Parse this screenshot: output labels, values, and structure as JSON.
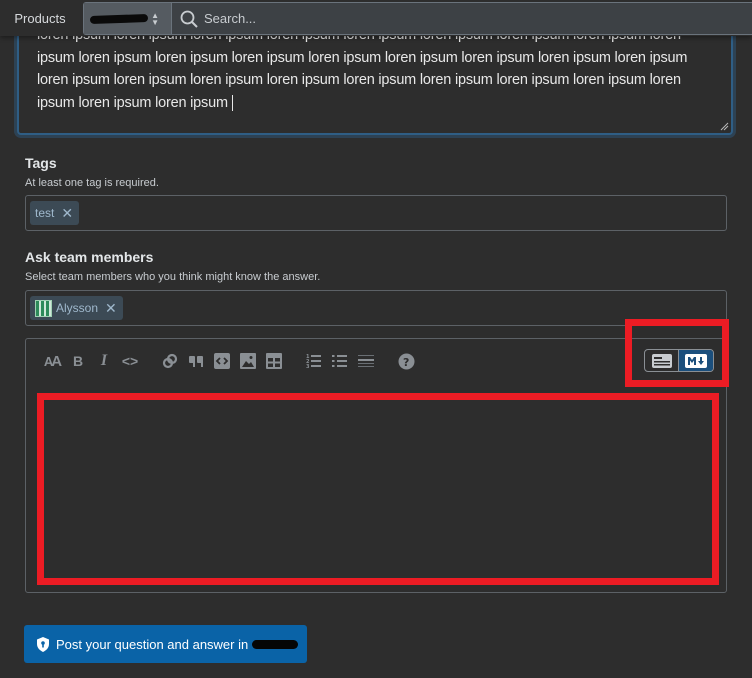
{
  "topbar": {
    "products_label": "Products",
    "search_scope": "[redacted]",
    "search_placeholder": "Search..."
  },
  "body": {
    "text": "loren ipsum loren ipsum loren ipsum loren ipsum loren ipsum loren ipsum loren ipsum loren ipsum loren ipsum loren ipsum loren ipsum loren ipsum loren ipsum loren ipsum loren ipsum loren ipsum loren ipsum loren ipsum loren ipsum loren ipsum loren ipsum loren ipsum loren ipsum loren ipsum loren ipsum loren ipsum loren ipsum loren ipsum"
  },
  "tags": {
    "label": "Tags",
    "description": "At least one tag is required.",
    "items": [
      {
        "label": "test"
      }
    ]
  },
  "team": {
    "label": "Ask team members",
    "description": "Select team members who you think might know the answer.",
    "members": [
      {
        "name": "Alysson"
      }
    ]
  },
  "editor": {
    "toolbar": [
      {
        "icon": "heading-icon",
        "glyph": "AA"
      },
      {
        "icon": "bold-icon",
        "glyph": "B"
      },
      {
        "icon": "italic-icon",
        "glyph": "I"
      },
      {
        "icon": "code-icon",
        "glyph": "<>"
      },
      {
        "icon": "link-icon"
      },
      {
        "icon": "blockquote-icon"
      },
      {
        "icon": "code-block-icon"
      },
      {
        "icon": "image-icon"
      },
      {
        "icon": "table-icon"
      },
      {
        "icon": "ordered-list-icon"
      },
      {
        "icon": "unordered-list-icon"
      },
      {
        "icon": "horizontal-rule-icon"
      },
      {
        "icon": "help-icon",
        "glyph": "?"
      }
    ],
    "mode": {
      "rich_text": "rich-text-mode",
      "markdown": "markdown-mode",
      "active": "markdown"
    },
    "content": ""
  },
  "submit": {
    "label": "Post your question and answer in",
    "target": "[redacted]"
  },
  "colors": {
    "accent": "#0a63a7",
    "highlight": "#ec1c24",
    "focus": "#2f5e85"
  }
}
